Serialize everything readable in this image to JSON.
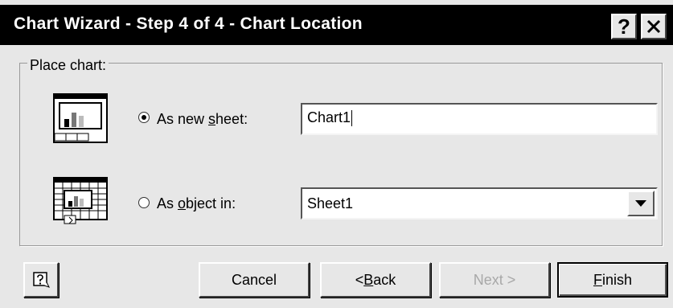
{
  "window": {
    "title": "Chart Wizard - Step 4 of 4 - Chart Location",
    "help_glyph": "?",
    "close_glyph": "✕"
  },
  "place_group": {
    "label": "Place chart:"
  },
  "option_new_sheet": {
    "label_pre": "As new ",
    "label_accel": "s",
    "label_post": "heet:",
    "selected": true,
    "value": "Chart1",
    "icon": "chart-sheet-icon"
  },
  "option_object_in": {
    "label_pre": "As ",
    "label_accel": "o",
    "label_post": "bject in:",
    "selected": false,
    "value": "Sheet1",
    "icon": "embedded-chart-icon"
  },
  "buttons": {
    "cancel": "Cancel",
    "back_pre": "< ",
    "back_accel": "B",
    "back_post": "ack",
    "next": "Next >",
    "finish_accel": "F",
    "finish_post": "inish"
  }
}
